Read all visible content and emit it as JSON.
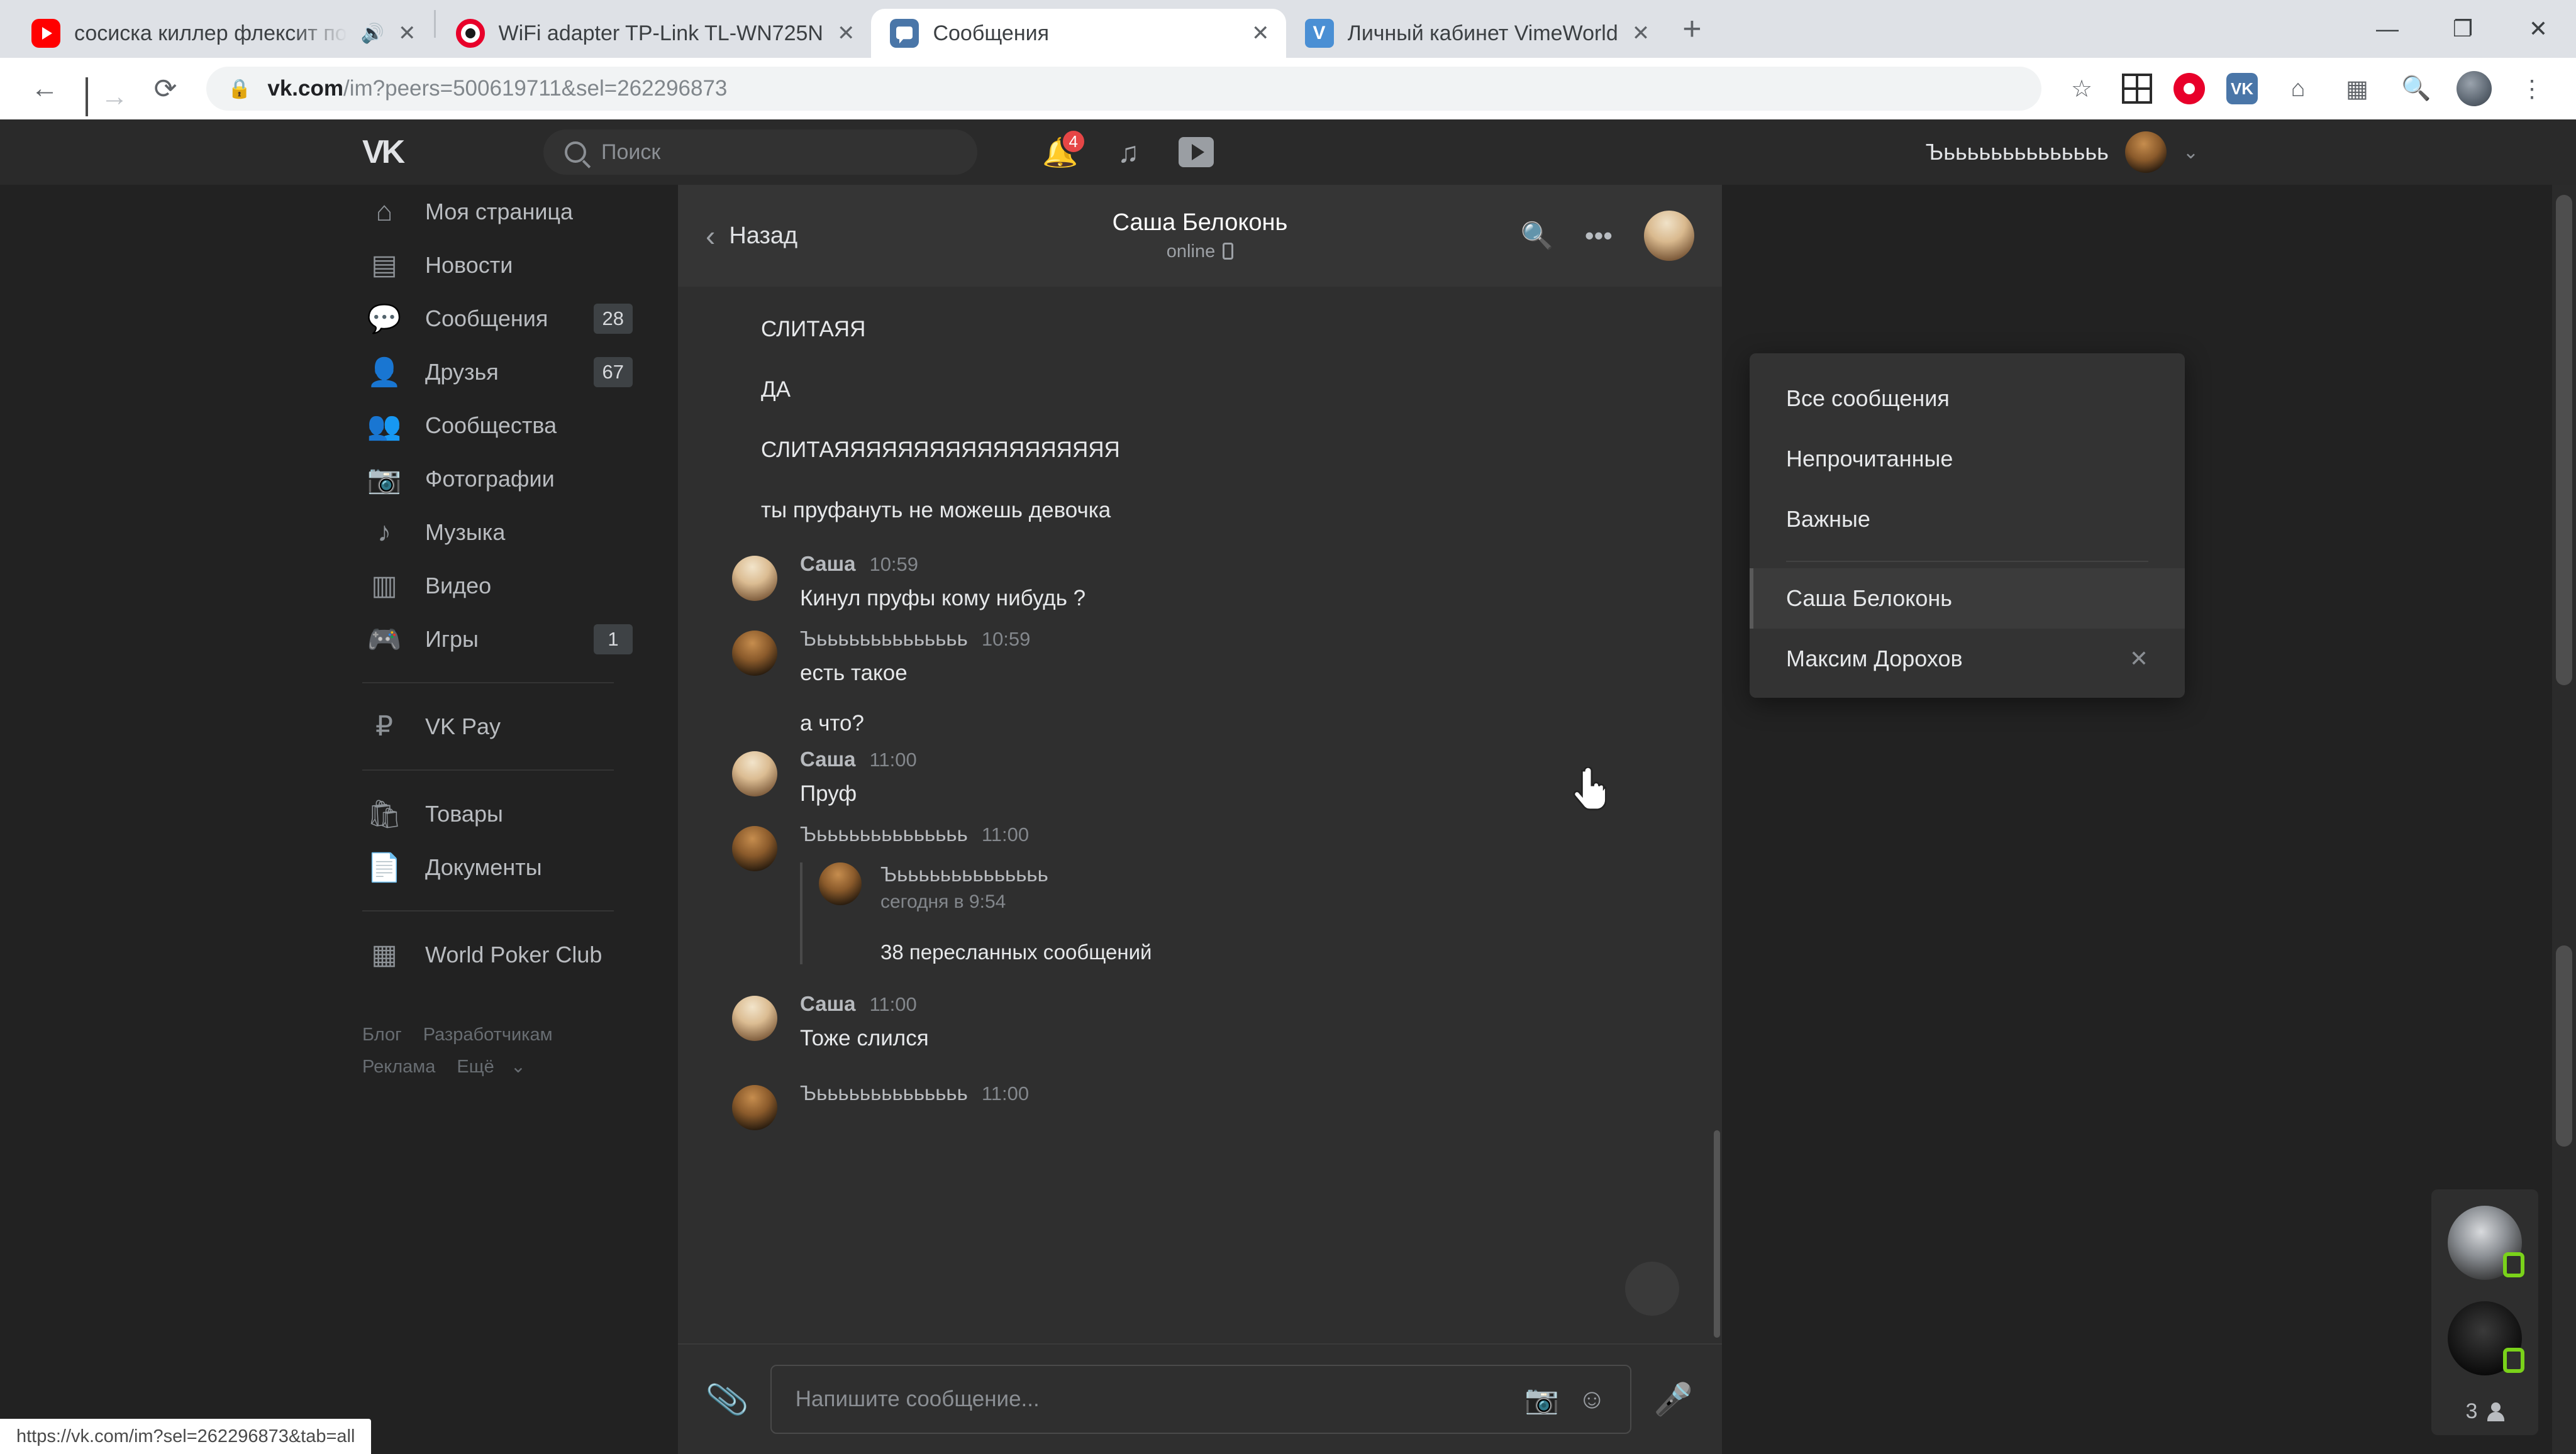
{
  "browser": {
    "tabs": [
      {
        "title": "сосиска киллер флексит по",
        "favicon": "youtube-icon",
        "audible": true,
        "active": false
      },
      {
        "title": "WiFi adapter TP-Link TL-WN725N",
        "favicon": "opera-icon",
        "audible": false,
        "active": false
      },
      {
        "title": "Сообщения",
        "favicon": "vk-messages-icon",
        "audible": false,
        "active": true
      },
      {
        "title": "Личный кабинет VimeWorld",
        "favicon": "vimeworld-icon",
        "audible": false,
        "active": false
      }
    ],
    "new_tab_label": "+",
    "window_controls": {
      "minimize": "—",
      "maximize": "❐",
      "close": "✕"
    },
    "nav": {
      "back": "←",
      "forward": "→",
      "reload": "⟳"
    },
    "url_domain": "vk.com",
    "url_path": "/im?peers=500619711&sel=262296873",
    "bookmark_star": "☆",
    "menu": "⋮",
    "status_url": "https://vk.com/im?sel=262296873&tab=all"
  },
  "vk_header": {
    "logo": "VK",
    "search_placeholder": "Поиск",
    "notifications_count": "4",
    "user_name": "Ъьььььььььььььь"
  },
  "sidebar": {
    "items": [
      {
        "label": "Моя страница",
        "icon": "home-icon",
        "badge": null
      },
      {
        "label": "Новости",
        "icon": "news-icon",
        "badge": null
      },
      {
        "label": "Сообщения",
        "icon": "messages-icon",
        "badge": "28"
      },
      {
        "label": "Друзья",
        "icon": "friends-icon",
        "badge": "67"
      },
      {
        "label": "Сообщества",
        "icon": "groups-icon",
        "badge": null
      },
      {
        "label": "Фотографии",
        "icon": "photos-icon",
        "badge": null
      },
      {
        "label": "Музыка",
        "icon": "music-icon",
        "badge": null
      },
      {
        "label": "Видео",
        "icon": "video-icon",
        "badge": null
      },
      {
        "label": "Игры",
        "icon": "games-icon",
        "badge": "1"
      }
    ],
    "group2": [
      {
        "label": "VK Pay",
        "icon": "vkpay-icon",
        "badge": null
      }
    ],
    "group3": [
      {
        "label": "Товары",
        "icon": "goods-icon",
        "badge": null
      },
      {
        "label": "Документы",
        "icon": "documents-icon",
        "badge": null
      }
    ],
    "group4": [
      {
        "label": "World Poker Club",
        "icon": "apps-icon",
        "badge": null
      }
    ],
    "footer_links": [
      "Блог",
      "Разработчикам",
      "Реклама",
      "Ещё"
    ],
    "footer_more_chevron": "⌄"
  },
  "chat": {
    "back_label": "Назад",
    "title": "Саша Белоконь",
    "status": "online",
    "search_icon": "search-icon",
    "more_icon": "more-dots-icon",
    "loose_lines": [
      "СЛИТАЯЯ",
      "ДА",
      "СЛИТАЯЯЯЯЯЯЯЯЯЯЯЯЯЯЯЯЯЯ",
      "ты пруфануть не можешь девочка"
    ],
    "messages": [
      {
        "author": "Саша",
        "time": "10:59",
        "avatar": "sasha",
        "bold_name": true,
        "lines": [
          "Кинул пруфы кому нибудь ?"
        ]
      },
      {
        "author": "Ъьььььььььььььь",
        "time": "10:59",
        "avatar": "me",
        "bold_name": false,
        "lines": [
          "есть такое",
          "а что?"
        ]
      },
      {
        "author": "Саша",
        "time": "11:00",
        "avatar": "sasha",
        "bold_name": true,
        "lines": [
          "Пруф"
        ]
      },
      {
        "author": "Ъьььььььььььььь",
        "time": "11:00",
        "avatar": "me",
        "bold_name": false,
        "lines": [],
        "forward": {
          "author": "Ъьььььььььььььь",
          "time": "сегодня в 9:54",
          "count_label": "38 пересланных сообщений"
        }
      },
      {
        "author": "Саша",
        "time": "11:00",
        "avatar": "sasha",
        "bold_name": true,
        "lines": [
          "Тоже слился"
        ]
      },
      {
        "author": "Ъьььььььььььььь",
        "time": "11:00",
        "avatar": "me",
        "bold_name": false,
        "lines": []
      }
    ],
    "scroll_down_icon": "chevron-down-icon",
    "composer": {
      "attach_icon": "paperclip-icon",
      "placeholder": "Напишите сообщение...",
      "camera_icon": "camera-icon",
      "emoji_icon": "emoji-icon",
      "mic_icon": "microphone-icon"
    }
  },
  "dropdown": {
    "filters": [
      "Все сообщения",
      "Непрочитанные",
      "Важные"
    ],
    "peers": [
      {
        "label": "Саша Белоконь",
        "active": true,
        "closable": false
      },
      {
        "label": "Максим Дорохов",
        "active": false,
        "closable": true,
        "close": "✕"
      }
    ]
  },
  "friends_widget": {
    "count": "3"
  },
  "colors": {
    "page_bg": "#222222",
    "panel_bg": "#2f2f2f",
    "header_bg": "#2a2a2a",
    "accent_badge": "#e64646",
    "online_green": "#7ad21a",
    "text_primary": "#e6e8ea",
    "text_muted": "#83878c"
  }
}
